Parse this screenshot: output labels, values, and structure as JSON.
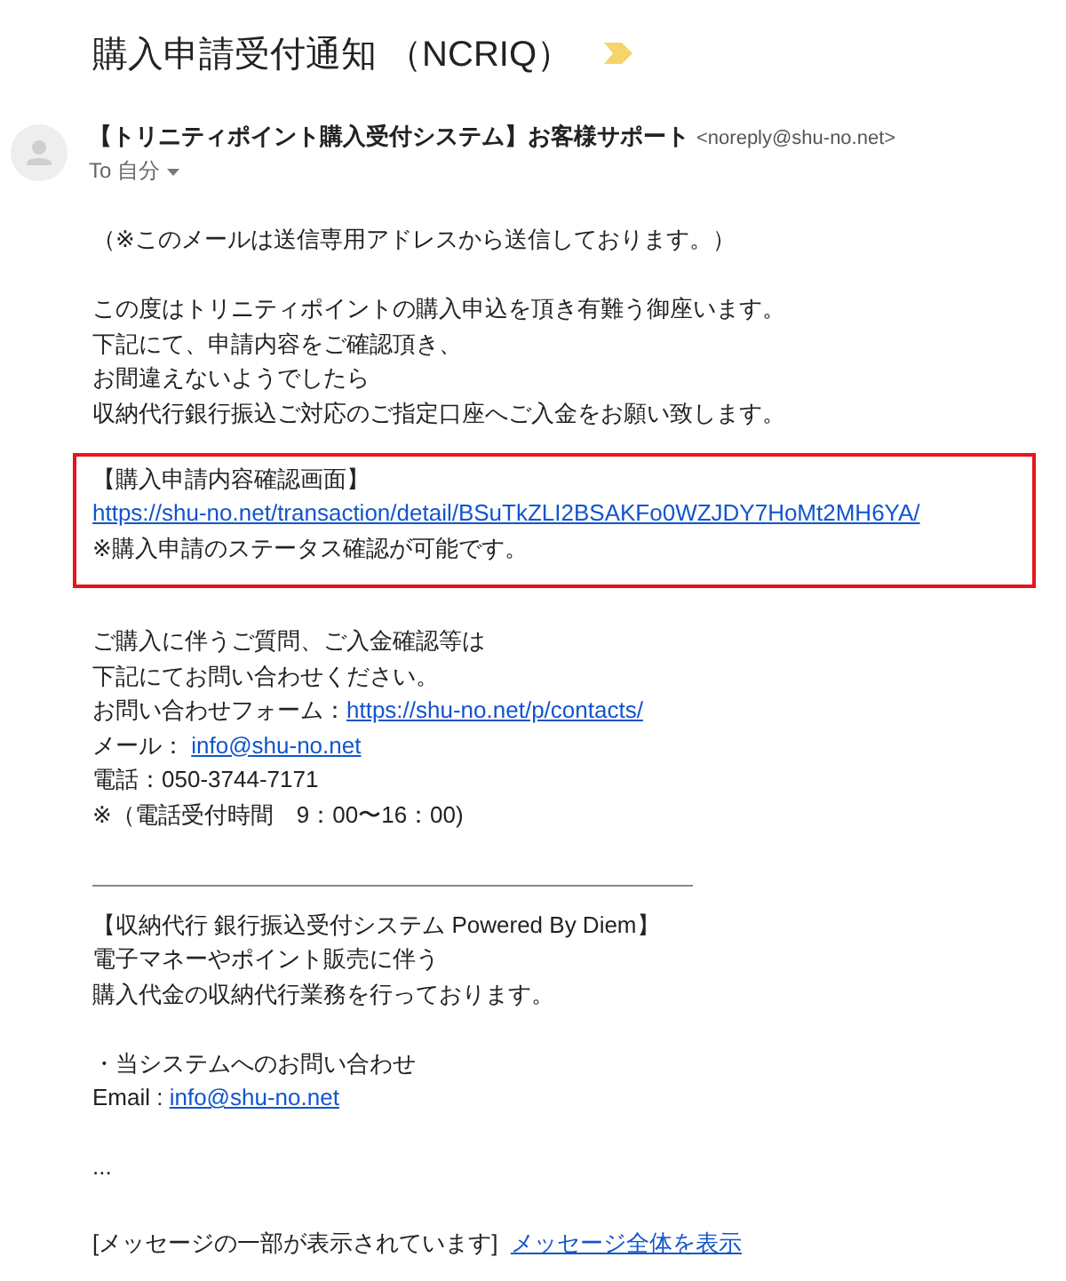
{
  "subject": "購入申請受付通知 （NCRIQ）",
  "important": true,
  "sender": {
    "name": "【トリニティポイント購入受付システム】お客様サポート",
    "email": "<noreply@shu-no.net>",
    "to": "To 自分"
  },
  "body": [
    {
      "kind": "paragraph",
      "lines": [
        {
          "text": "（※このメールは送信専用アドレスから送信しております。）"
        }
      ]
    },
    {
      "kind": "paragraph",
      "lines": [
        {
          "text": "この度はトリニティポイントの購入申込を頂き有難う御座います。"
        },
        {
          "text": "下記にて、申請内容をご確認頂き、"
        },
        {
          "text": "お間違えないようでしたら"
        },
        {
          "text": "収納代行銀行振込ご対応のご指定口座へご入金をお願い致します。"
        }
      ]
    },
    {
      "kind": "boxed",
      "lines": [
        {
          "text": "【購入申請内容確認画面】"
        },
        {
          "link": "https://shu-no.net/transaction/detail/BSuTkZLI2BSAKFo0WZJDY7HoMt2MH6YA/"
        },
        {
          "text": "※購入申請のステータス確認が可能です。"
        }
      ]
    },
    {
      "kind": "paragraph",
      "lines": [
        {
          "text": "ご購入に伴うご質問、ご入金確認等は"
        },
        {
          "text": "下記にてお問い合わせください。"
        },
        {
          "text": "お問い合わせフォーム：",
          "link": "https://shu-no.net/p/contacts/"
        },
        {
          "text": "メール： ",
          "link": "info@shu-no.net"
        },
        {
          "text": "電話：050-3744-7171"
        },
        {
          "text": "※（電話受付時間　9：00〜16：00)"
        }
      ]
    },
    {
      "kind": "rule"
    },
    {
      "kind": "paragraph",
      "lines": [
        {
          "text": "【収納代行 銀行振込受付システム Powered By Diem】"
        },
        {
          "text": "電子マネーやポイント販売に伴う"
        },
        {
          "text": "購入代金の収納代行業務を行っております。"
        }
      ]
    },
    {
      "kind": "paragraph",
      "lines": [
        {
          "text": "・当システムへのお問い合わせ"
        },
        {
          "text": "Email : ",
          "link": "info@shu-no.net"
        }
      ]
    },
    {
      "kind": "paragraph",
      "lines": [
        {
          "text": "..."
        }
      ]
    },
    {
      "kind": "footer",
      "lines": [
        {
          "text": "[メッセージの一部が表示されています]  ",
          "link": "メッセージ全体を表示"
        }
      ]
    }
  ]
}
